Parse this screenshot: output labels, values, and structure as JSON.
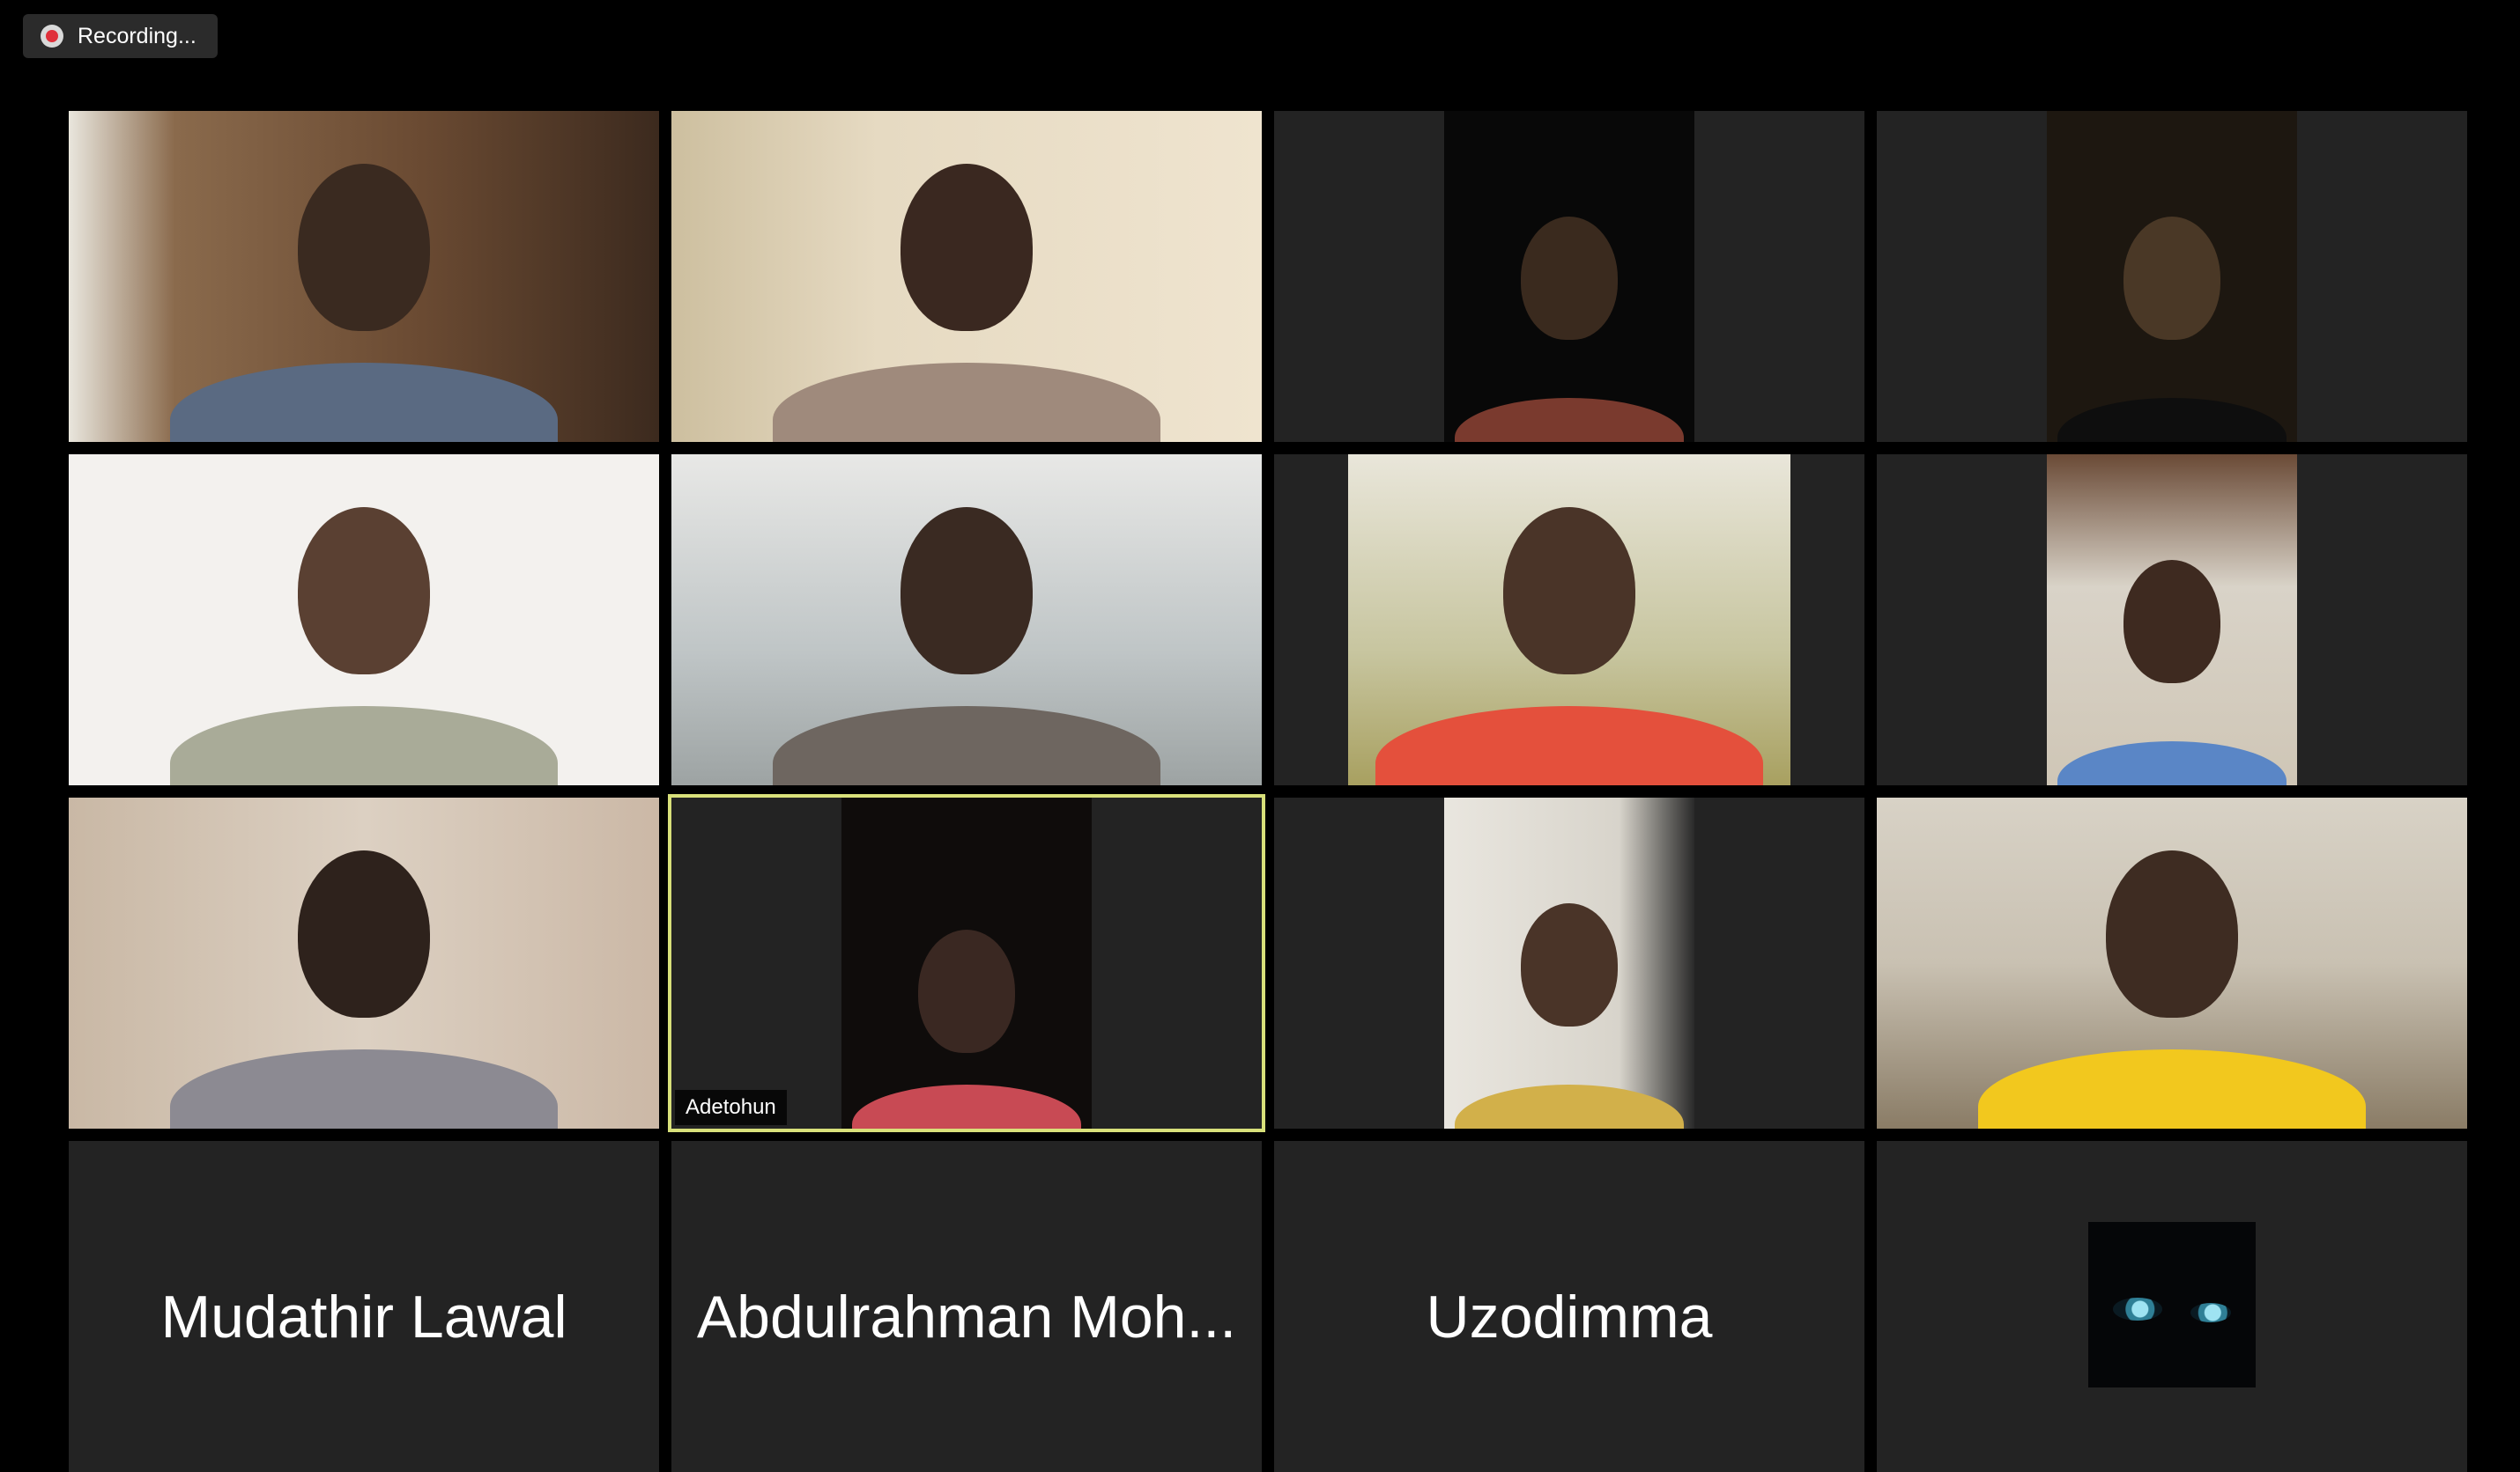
{
  "toolbar": {
    "recording_label": "Recording..."
  },
  "participants": [
    {
      "type": "video",
      "name": ""
    },
    {
      "type": "video",
      "name": ""
    },
    {
      "type": "video",
      "name": ""
    },
    {
      "type": "video",
      "name": ""
    },
    {
      "type": "video",
      "name": ""
    },
    {
      "type": "video",
      "name": ""
    },
    {
      "type": "video",
      "name": ""
    },
    {
      "type": "video",
      "name": ""
    },
    {
      "type": "video",
      "name": ""
    },
    {
      "type": "video",
      "name": "Adetohun",
      "active_speaker": true
    },
    {
      "type": "video",
      "name": ""
    },
    {
      "type": "video",
      "name": ""
    },
    {
      "type": "name",
      "name": "Mudathir Lawal"
    },
    {
      "type": "name",
      "name": "Abdulrahman Moh..."
    },
    {
      "type": "name",
      "name": "Uzodimma"
    },
    {
      "type": "avatar",
      "name": "",
      "icon": "eyes-avatar-icon"
    }
  ],
  "colors": {
    "background": "#000000",
    "tile": "#232323",
    "active_speaker_border": "#d8e07a",
    "recording_dot": "#e0303a"
  }
}
